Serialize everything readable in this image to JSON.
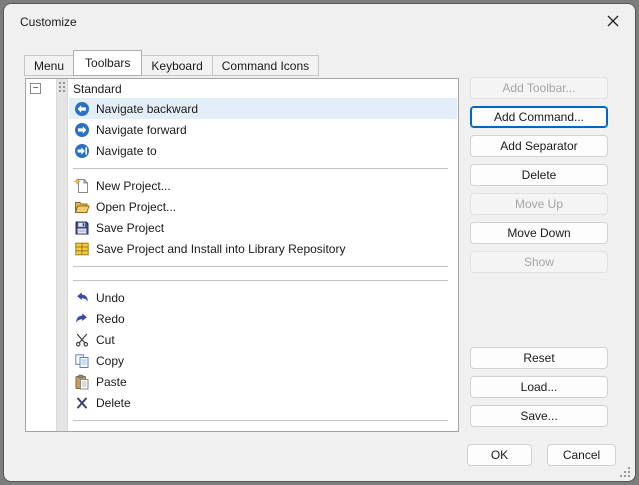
{
  "colors": {
    "accent": "#0067c0",
    "selection_bg": "#e4eef9",
    "dialog_bg": "#f0f0f0",
    "icon_blue": "#2a70c2"
  },
  "window": {
    "title": "Customize"
  },
  "tabs": [
    {
      "label": "Menu",
      "active": false
    },
    {
      "label": "Toolbars",
      "active": true
    },
    {
      "label": "Keyboard",
      "active": false
    },
    {
      "label": "Command Icons",
      "active": false
    }
  ],
  "toolbar_tree": {
    "collapse_glyph": "−",
    "items": [
      {
        "type": "header",
        "label": "Standard"
      },
      {
        "type": "item",
        "icon": "navigate-backward",
        "label": "Navigate backward",
        "selected": true
      },
      {
        "type": "item",
        "icon": "navigate-forward",
        "label": "Navigate forward",
        "selected": false
      },
      {
        "type": "item",
        "icon": "navigate-to",
        "label": "Navigate to",
        "selected": false
      },
      {
        "type": "separator"
      },
      {
        "type": "item",
        "icon": "new-project",
        "label": "New Project...",
        "selected": false
      },
      {
        "type": "item",
        "icon": "open-project",
        "label": "Open Project...",
        "selected": false
      },
      {
        "type": "item",
        "icon": "save-project",
        "label": "Save Project",
        "selected": false
      },
      {
        "type": "item",
        "icon": "save-install",
        "label": "Save Project and Install into Library Repository",
        "selected": false
      },
      {
        "type": "separator"
      },
      {
        "type": "separator"
      },
      {
        "type": "item",
        "icon": "undo",
        "label": "Undo",
        "selected": false
      },
      {
        "type": "item",
        "icon": "redo",
        "label": "Redo",
        "selected": false
      },
      {
        "type": "item",
        "icon": "cut",
        "label": "Cut",
        "selected": false
      },
      {
        "type": "item",
        "icon": "copy",
        "label": "Copy",
        "selected": false
      },
      {
        "type": "item",
        "icon": "paste",
        "label": "Paste",
        "selected": false
      },
      {
        "type": "item",
        "icon": "delete",
        "label": "Delete",
        "selected": false
      },
      {
        "type": "separator"
      }
    ]
  },
  "action_buttons": {
    "primary": [
      {
        "label": "Add Toolbar...",
        "enabled": false,
        "default": false
      },
      {
        "label": "Add Command...",
        "enabled": true,
        "default": true
      },
      {
        "label": "Add Separator",
        "enabled": true,
        "default": false
      },
      {
        "label": "Delete",
        "enabled": true,
        "default": false
      },
      {
        "label": "Move Up",
        "enabled": false,
        "default": false
      },
      {
        "label": "Move Down",
        "enabled": true,
        "default": false
      },
      {
        "label": "Show",
        "enabled": false,
        "default": false
      }
    ],
    "secondary": [
      {
        "label": "Reset",
        "enabled": true,
        "default": false
      },
      {
        "label": "Load...",
        "enabled": true,
        "default": false
      },
      {
        "label": "Save...",
        "enabled": true,
        "default": false
      }
    ]
  },
  "footer": {
    "ok_label": "OK",
    "cancel_label": "Cancel"
  }
}
